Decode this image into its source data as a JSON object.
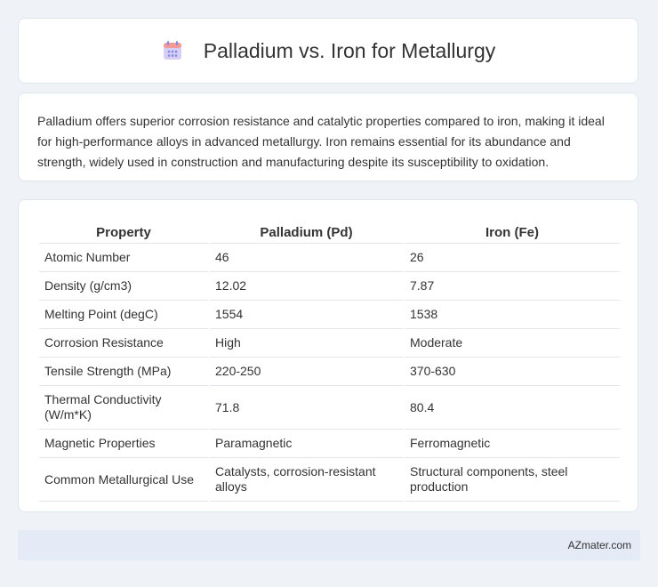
{
  "header": {
    "title": "Palladium vs. Iron for Metallurgy",
    "icon": "calendar-icon",
    "icon_colors": {
      "top": "#f08080",
      "body": "#c9b8f0",
      "dots": "#7a8ee0"
    }
  },
  "intro": {
    "text": "Palladium offers superior corrosion resistance and catalytic properties compared to iron, making it ideal for high-performance alloys in advanced metallurgy. Iron remains essential for its abundance and strength, widely used in construction and manufacturing despite its susceptibility to oxidation."
  },
  "table": {
    "headers": [
      "Property",
      "Palladium (Pd)",
      "Iron (Fe)"
    ],
    "rows": [
      [
        "Atomic Number",
        "46",
        "26"
      ],
      [
        "Density (g/cm3)",
        "12.02",
        "7.87"
      ],
      [
        "Melting Point (degC)",
        "1554",
        "1538"
      ],
      [
        "Corrosion Resistance",
        "High",
        "Moderate"
      ],
      [
        "Tensile Strength (MPa)",
        "220-250",
        "370-630"
      ],
      [
        "Thermal Conductivity (W/m*K)",
        "71.8",
        "80.4"
      ],
      [
        "Magnetic Properties",
        "Paramagnetic",
        "Ferromagnetic"
      ],
      [
        "Common Metallurgical Use",
        "Catalysts, corrosion-resistant alloys",
        "Structural components, steel production"
      ]
    ]
  },
  "footer": {
    "brand": "AZmater.com"
  }
}
